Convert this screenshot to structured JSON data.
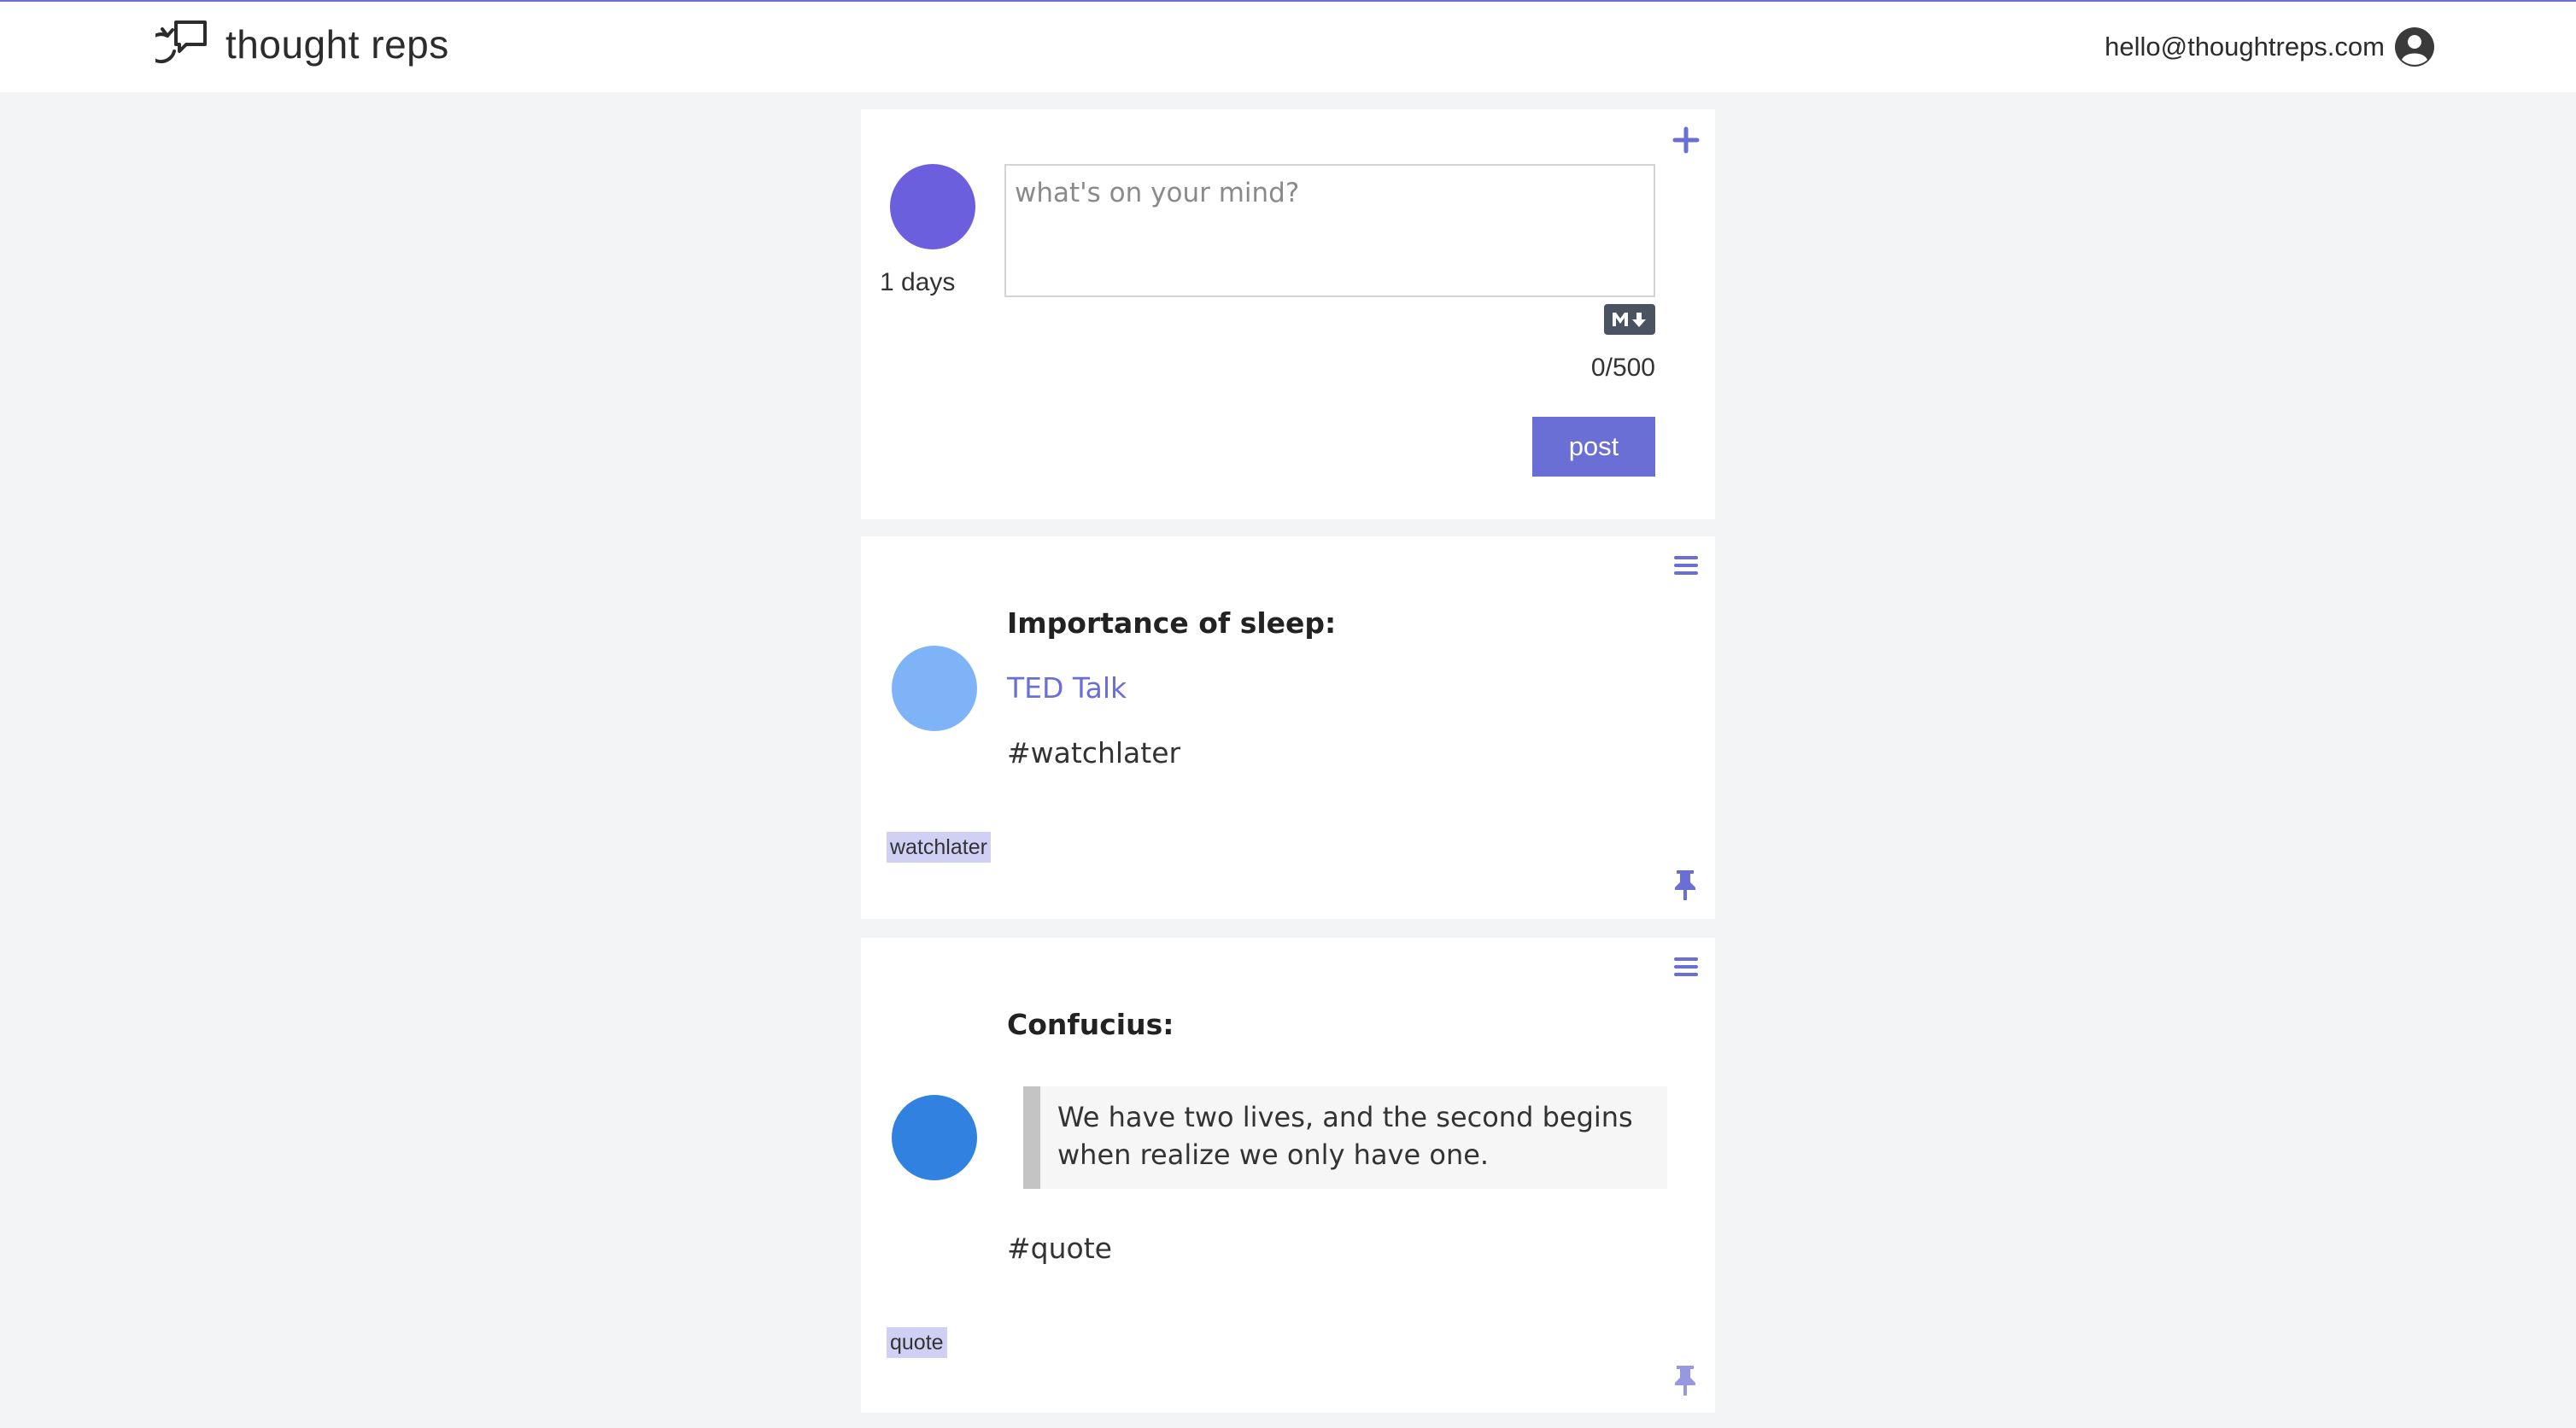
{
  "header": {
    "brand": "thought reps",
    "email": "hello@thoughtreps.com"
  },
  "composer": {
    "days": "1 days",
    "placeholder": "what's on your mind?",
    "value": "",
    "char_count": "0/500",
    "post_label": "post",
    "avatar_color": "#6b5fde"
  },
  "posts": [
    {
      "title": "Importance of sleep:",
      "link": "TED Talk",
      "hashtag": "#watchlater",
      "tag": "watchlater",
      "avatar_color": "#7fb3f7"
    },
    {
      "title": "Confucius:",
      "quote": "We have two lives, and the second begins when realize we only have one.",
      "hashtag": "#quote",
      "tag": "quote",
      "avatar_color": "#3181e0"
    }
  ],
  "colors": {
    "accent": "#6a6fd6",
    "tag_bg": "#cfd0f4",
    "background": "#f3f4f6"
  },
  "icons": [
    "thought-reps-logo-icon",
    "user-circle-icon",
    "plus-icon",
    "markdown-icon",
    "menu-icon",
    "pin-icon"
  ]
}
